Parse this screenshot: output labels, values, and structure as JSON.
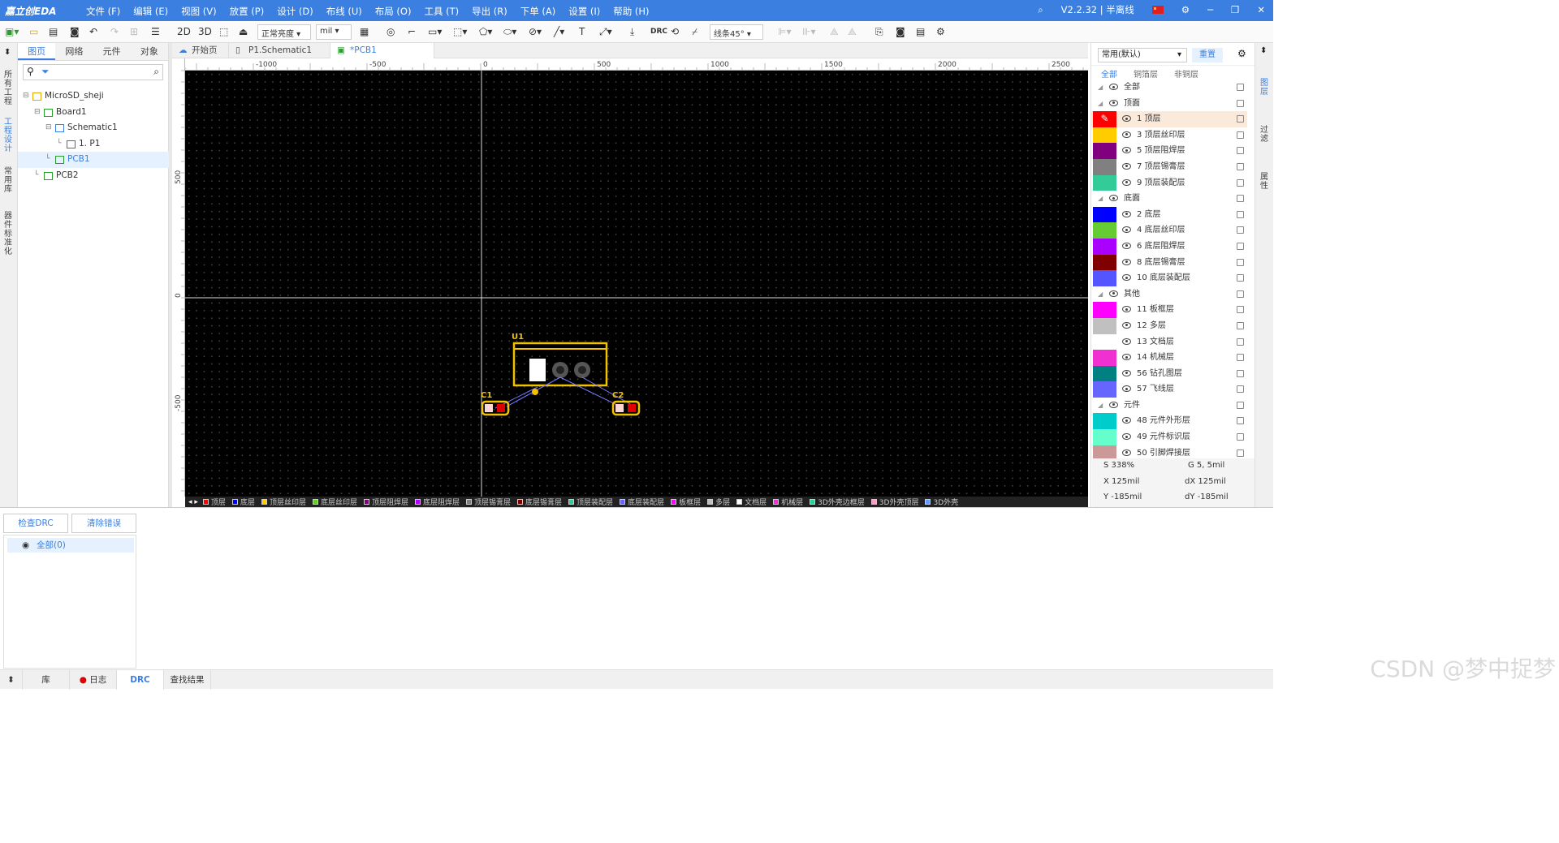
{
  "titlebar": {
    "logo": "嘉立创EDA",
    "menu": [
      "文件 (F)",
      "编辑 (E)",
      "视图 (V)",
      "放置 (P)",
      "设计 (D)",
      "布线 (U)",
      "布局 (O)",
      "工具 (T)",
      "导出 (R)",
      "下单 (A)",
      "设置 (I)",
      "帮助 (H)"
    ],
    "version": "V2.2.32 | 半离线"
  },
  "toolbar": {
    "btn_2d": "2D",
    "btn_3d": "3D",
    "brightness": "正常亮度",
    "unit": "mil",
    "route_mode": "线条45°",
    "drc": "DRC"
  },
  "lefttabs": [
    "所有工程",
    "工程设计",
    "常用库",
    "器件标准化"
  ],
  "leftpanel": {
    "tabs": [
      "图页",
      "网络",
      "元件",
      "对象"
    ],
    "tree": [
      {
        "label": "MicroSD_sheji",
        "level": 0
      },
      {
        "label": "Board1",
        "level": 1
      },
      {
        "label": "Schematic1",
        "level": 2
      },
      {
        "label": "1. P1",
        "level": 3
      },
      {
        "label": "PCB1",
        "level": 2
      },
      {
        "label": "PCB2",
        "level": 1
      }
    ]
  },
  "doctabs": [
    "开始页",
    "P1.Schematic1",
    "*PCB1"
  ],
  "ruler": {
    "h": [
      "-1000",
      "-500",
      "0",
      "500",
      "1000",
      "1500",
      "2000",
      "2500"
    ],
    "v": [
      "500",
      "0",
      "-500"
    ]
  },
  "canvas": {
    "designators": [
      "U1",
      "C1",
      "C2"
    ]
  },
  "layerbar": [
    {
      "name": "顶层",
      "color": "#ff0000"
    },
    {
      "name": "底层",
      "color": "#0000ff"
    },
    {
      "name": "顶层丝印层",
      "color": "#ffcc00"
    },
    {
      "name": "底层丝印层",
      "color": "#66cc33"
    },
    {
      "name": "顶层阻焊层",
      "color": "#800080"
    },
    {
      "name": "底层阻焊层",
      "color": "#aa00ff"
    },
    {
      "name": "顶层锡膏层",
      "color": "#808080"
    },
    {
      "name": "底层锡膏层",
      "color": "#800000"
    },
    {
      "name": "顶层装配层",
      "color": "#33cc99"
    },
    {
      "name": "底层装配层",
      "color": "#6666ff"
    },
    {
      "name": "板框层",
      "color": "#ff00ff"
    },
    {
      "name": "多层",
      "color": "#c0c0c0"
    },
    {
      "name": "文档层",
      "color": "#ffffff"
    },
    {
      "name": "机械层",
      "color": "#f030d0"
    },
    {
      "name": "3D外壳边框层",
      "color": "#33cc99"
    },
    {
      "name": "3D外壳顶层",
      "color": "#ff99cc"
    },
    {
      "name": "3D外壳",
      "color": "#6699ff"
    }
  ],
  "rightpanel": {
    "preset": "常用(默认)",
    "reset": "重置",
    "subtabs": [
      "全部",
      "铜箔层",
      "非铜层"
    ],
    "layers": [
      {
        "name": "全部",
        "group": true,
        "color": ""
      },
      {
        "name": "顶面",
        "group": true,
        "color": ""
      },
      {
        "name": "1 顶层",
        "color": "#ff0000",
        "current": true
      },
      {
        "name": "3 顶层丝印层",
        "color": "#ffcc00"
      },
      {
        "name": "5 顶层阻焊层",
        "color": "#800080"
      },
      {
        "name": "7 顶层锡膏层",
        "color": "#808080"
      },
      {
        "name": "9 顶层装配层",
        "color": "#33cc99"
      },
      {
        "name": "底面",
        "group": true,
        "color": ""
      },
      {
        "name": "2 底层",
        "color": "#0000ff"
      },
      {
        "name": "4 底层丝印层",
        "color": "#66cc33"
      },
      {
        "name": "6 底层阻焊层",
        "color": "#aa00ff"
      },
      {
        "name": "8 底层锡膏层",
        "color": "#800000"
      },
      {
        "name": "10 底层装配层",
        "color": "#5555ff"
      },
      {
        "name": "其他",
        "group": true,
        "color": ""
      },
      {
        "name": "11 板框层",
        "color": "#ff00ff"
      },
      {
        "name": "12 多层",
        "color": "#c0c0c0"
      },
      {
        "name": "13 文档层",
        "color": "#ffffff"
      },
      {
        "name": "14 机械层",
        "color": "#f030d0"
      },
      {
        "name": "56 钻孔图层",
        "color": "#008080"
      },
      {
        "name": "57 飞线层",
        "color": "#6666ff"
      },
      {
        "name": "元件",
        "group": true,
        "color": ""
      },
      {
        "name": "48 元件外形层",
        "color": "#00cccc"
      },
      {
        "name": "49 元件标识层",
        "color": "#66ffcc"
      },
      {
        "name": "50 引脚焊接层",
        "color": "#cc9999"
      }
    ],
    "status": {
      "s": "S  338%",
      "g": "G  5, 5mil",
      "x": "X  125mil",
      "dx": "dX  125mil",
      "y": "Y  -185mil",
      "dy": "dY  -185mil"
    }
  },
  "righttabs": [
    "图层",
    "过滤",
    "属性"
  ],
  "bottom": {
    "check_drc": "检查DRC",
    "clear_errors": "清除错误",
    "all_item": "全部(0)"
  },
  "statusbar": [
    "库",
    "日志",
    "DRC",
    "查找结果"
  ],
  "watermark": "CSDN @梦中捉梦"
}
